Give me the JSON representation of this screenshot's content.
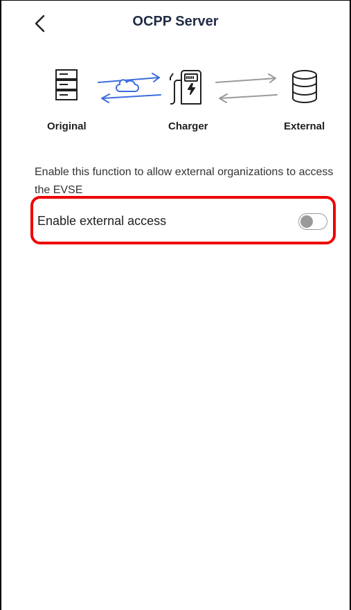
{
  "header": {
    "title": "OCPP Server",
    "back_icon": "chevron-left-icon"
  },
  "diagram": {
    "nodes": [
      {
        "label": "Original",
        "icon": "server-icon"
      },
      {
        "label": "Charger",
        "icon": "charger-icon"
      },
      {
        "label": "External",
        "icon": "database-icon"
      }
    ],
    "links": [
      {
        "icon": "cloud-sync-arrows-icon",
        "color": "#3b6de0"
      },
      {
        "icon": "sync-arrows-icon",
        "color": "#9a9a9a"
      }
    ]
  },
  "description": "Enable this function to allow external organizations to access the EVSE",
  "external_access": {
    "label": "Enable external access",
    "enabled": false,
    "highlight_color": "#ee0000"
  }
}
